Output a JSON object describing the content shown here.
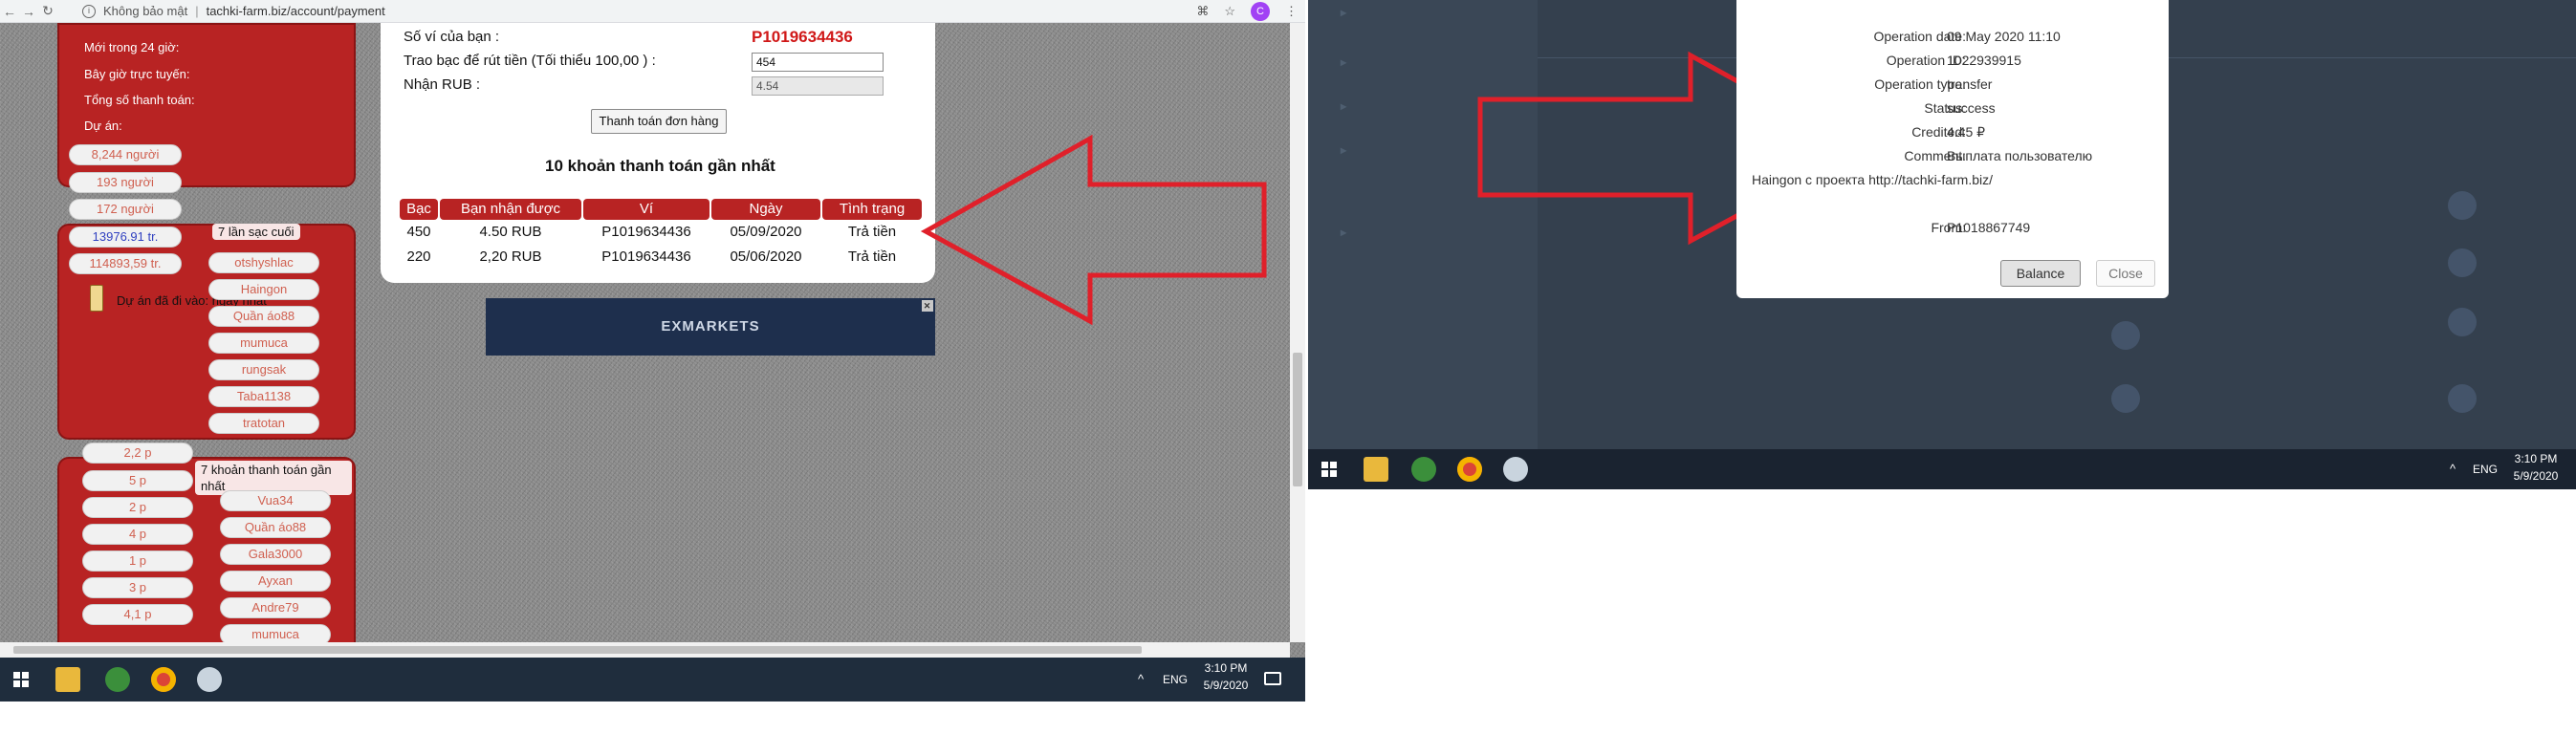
{
  "browser": {
    "security_label": "Không bảo mật",
    "url": "tachki-farm.biz/account/payment",
    "avatar_letter": "C"
  },
  "sidebar": {
    "stats_labels": [
      "Mới trong 24 giờ:",
      "Bây giờ trực tuyến:",
      "Tổng số thanh toán:",
      "Dự án:"
    ],
    "stat_pills": [
      "8,244 người",
      "193 người",
      "172 người"
    ],
    "balance_blue": "13976.91 tr.",
    "balance_other": "114893,59 tr.",
    "recent_topups_title": "7 lần sạc cuối",
    "project_text": "Dự án đã đi vào: ngày nhất",
    "topup_users": [
      "otshyshlac",
      "Haingon",
      "Quần áo88",
      "mumuca",
      "rungsak",
      "Taba1138",
      "tratotan"
    ],
    "payout_amounts": [
      "2,2 p",
      "5 p",
      "2 p",
      "4 p",
      "1 p",
      "3 p",
      "4,1 p"
    ],
    "recent_payouts_title": "7 khoản thanh toán gần nhất",
    "payout_users": [
      "Vua34",
      "Quần áo88",
      "Gala3000",
      "Ayxan",
      "Andre79",
      "mumuca"
    ]
  },
  "payment_form": {
    "wallet_label": "Số ví của bạn :",
    "wallet_value": "P1019634436",
    "amount_label": "Trao bạc để rút tiền (Tối thiểu 100,00 ) :",
    "amount_value": "454",
    "rub_label": "Nhận RUB :",
    "rub_value": "4.54",
    "submit_label": "Thanh toán đơn hàng"
  },
  "payments_table": {
    "title": "10 khoản thanh toán gần nhất",
    "headers": [
      "Bạc",
      "Bạn nhận được",
      "Ví",
      "Ngày",
      "Tình trạng"
    ],
    "rows": [
      {
        "silver": "450",
        "received": "4.50 RUB",
        "wallet": "P1019634436",
        "date": "05/09/2020",
        "status": "Trả tiền"
      },
      {
        "silver": "220",
        "received": "2,20 RUB",
        "wallet": "P1019634436",
        "date": "05/06/2020",
        "status": "Trả tiền"
      }
    ]
  },
  "ad": {
    "brand": "EXMARKETS",
    "close": "✕"
  },
  "taskbar_left": {
    "lang": "ENG",
    "time": "3:10 PM",
    "date": "5/9/2020"
  },
  "taskbar_right": {
    "lang": "ENG",
    "time": "3:10 PM",
    "date": "5/9/2020"
  },
  "operation_dialog": {
    "date_label": "Operation date:",
    "date_value": "09 May 2020 11:10",
    "id_label": "Operation ID:",
    "id_value": "1022939915",
    "type_label": "Operation type:",
    "type_value": "transfer",
    "status_label": "Status:",
    "status_value": "success",
    "credited_label": "Credited:",
    "credited_value": "4.45 ₽",
    "comment_label": "Comment:",
    "comment_value": "Выплата пользователю",
    "comment_extra": "Haingon с проекта http://tachki-farm.biz/",
    "from_label": "From:",
    "from_value": "P1018867749",
    "balance_button": "Balance",
    "close_button": "Close"
  },
  "colors": {
    "panel_red": "#b82323",
    "wallet_red": "#d01818",
    "arrow_red": "#e0202a",
    "dark_bg": "#34404e",
    "taskbar": "#1f2d3d"
  }
}
